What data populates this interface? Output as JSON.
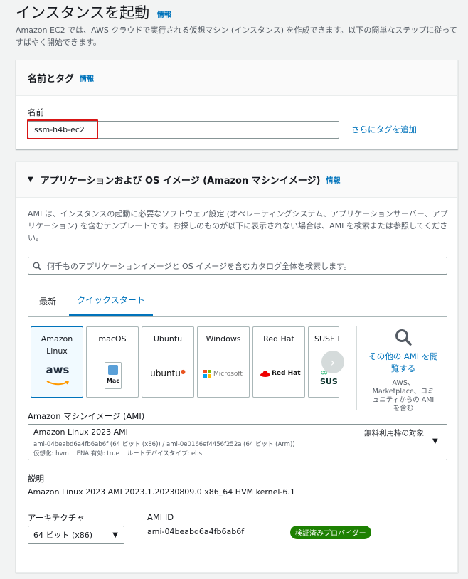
{
  "page": {
    "title": "インスタンスを起動",
    "title_info": "情報",
    "description": "Amazon EC2 では、AWS クラウドで実行される仮想マシン (インスタンス) を作成できます。以下の簡単なステップに従ってすばやく開始できます。"
  },
  "name_tags": {
    "header": "名前とタグ",
    "info": "情報",
    "name_label": "名前",
    "name_value": "ssm-h4b-ec2",
    "add_tags_link": "さらにタグを追加"
  },
  "ami_section": {
    "header": "アプリケーションおよび OS イメージ (Amazon マシンイメージ)",
    "info": "情報",
    "description": "AMI は、インスタンスの起動に必要なソフトウェア設定 (オペレーティングシステム、アプリケーションサーバー、アプリケーション) を含むテンプレートです。お探しのものが以下に表示されない場合は、AMI を検索または参照してください。",
    "search_placeholder": "何千ものアプリケーションイメージと OS イメージを含むカタログ全体を検索します。",
    "tabs": [
      {
        "label": "最新",
        "active": false
      },
      {
        "label": "クイックスタート",
        "active": true
      }
    ],
    "tiles": [
      {
        "name": "Amazon Linux",
        "logo": "aws",
        "selected": true
      },
      {
        "name": "macOS",
        "logo": "Mac",
        "selected": false
      },
      {
        "name": "Ubuntu",
        "logo": "ubuntu",
        "selected": false
      },
      {
        "name": "Windows",
        "logo": "Microsoft",
        "selected": false
      },
      {
        "name": "Red Hat",
        "logo": "Red Hat",
        "selected": false
      },
      {
        "name": "SUSE L",
        "logo": "SUS",
        "selected": false
      }
    ],
    "browse_more": "その他の AMI を閲覧する",
    "browse_more_sub": "AWS、Marketplace、コミュニティからの AMI を含む",
    "ami_label": "Amazon マシンイメージ (AMI)",
    "selected_ami": {
      "name": "Amazon Linux 2023 AMI",
      "free_tier": "無料利用枠の対象",
      "ids": "ami-04beabd6a4fb6ab6f (64 ビット (x86)) / ami-0e0166ef4456f252a (64 ビット (Arm))",
      "details": "仮想化: hvm    ENA 有効: true    ルートデバイスタイプ: ebs"
    },
    "desc_label": "説明",
    "desc_value": "Amazon Linux 2023 AMI 2023.1.20230809.0 x86_64 HVM kernel-6.1",
    "arch_label": "アーキテクチャ",
    "arch_value": "64 ビット (x86)",
    "ami_id_label": "AMI ID",
    "ami_id_value": "ami-04beabd6a4fb6ab6f",
    "verified_badge": "検証済みプロバイダー"
  },
  "colors": {
    "link": "#0073bb",
    "highlight_red": "#d91515",
    "badge_green": "#1d8102",
    "aws_orange": "#ff9900",
    "redhat_red": "#ee0000",
    "ubuntu_orange": "#e95420"
  }
}
